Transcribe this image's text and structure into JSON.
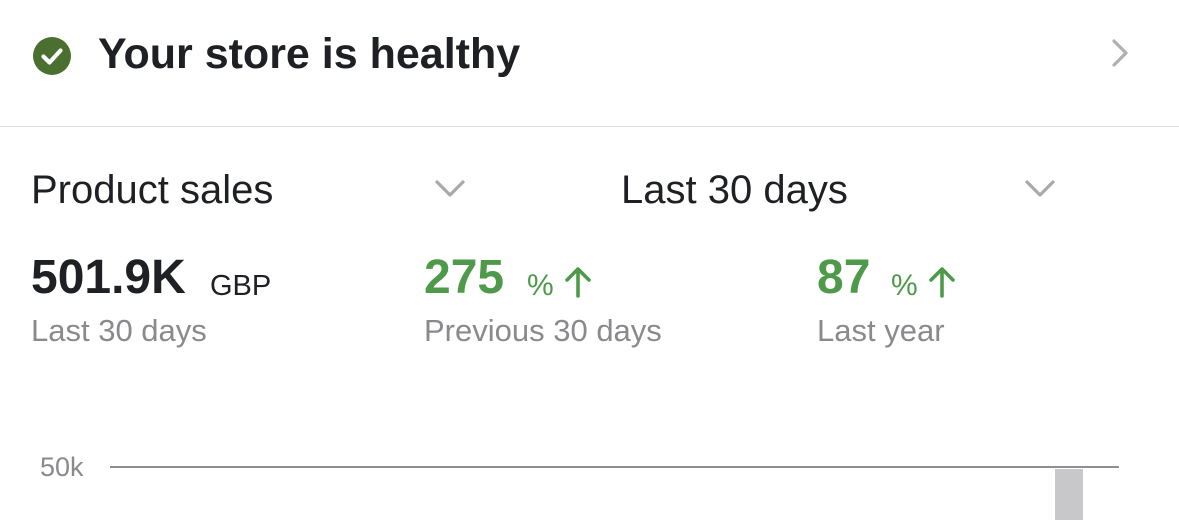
{
  "health": {
    "text": "Your store is healthy",
    "icon": "check-circle-icon",
    "icon_color": "#4a6f2f"
  },
  "controls": {
    "metric_select": {
      "label": "Product sales"
    },
    "period_select": {
      "label": "Last 30 days"
    }
  },
  "metrics": {
    "primary": {
      "value": "501.9K",
      "unit": "GBP",
      "caption": "Last 30 days"
    },
    "vs_previous": {
      "value": "275",
      "unit": "%",
      "direction": "up",
      "caption": "Previous 30 days"
    },
    "vs_last_year": {
      "value": "87",
      "unit": "%",
      "direction": "up",
      "caption": "Last year"
    }
  },
  "colors": {
    "positive": "#4f9a4a",
    "text": "#1f2023",
    "muted": "#8a8a8e",
    "bar": "#c8c8cb"
  },
  "chart_data": {
    "type": "bar",
    "y_tick_labels": [
      "50k"
    ],
    "visible_bar_count": 1
  }
}
